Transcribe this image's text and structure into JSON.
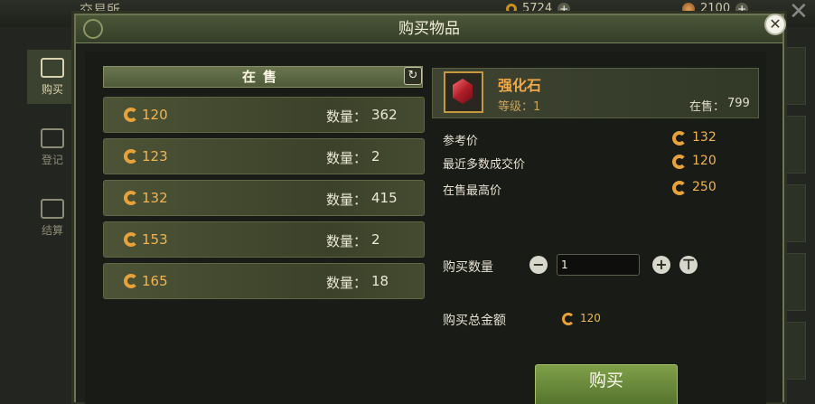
{
  "background": {
    "title": "交易所",
    "currency1_value": "5724",
    "currency2_value": "2100",
    "sidebar": [
      {
        "label": "购买",
        "active": true
      },
      {
        "label": "登记",
        "active": false
      },
      {
        "label": "结算",
        "active": false
      }
    ]
  },
  "modal": {
    "title": "购买物品",
    "list_header": "在售",
    "listings": [
      {
        "price": "120",
        "qty_label": "数量：",
        "qty": "362"
      },
      {
        "price": "123",
        "qty_label": "数量：",
        "qty": "2"
      },
      {
        "price": "132",
        "qty_label": "数量：",
        "qty": "415"
      },
      {
        "price": "153",
        "qty_label": "数量：",
        "qty": "2"
      },
      {
        "price": "165",
        "qty_label": "数量：",
        "qty": "18"
      }
    ],
    "item": {
      "name": "强化石",
      "level": "等级：1",
      "on_sale_label": "在售：",
      "on_sale_value": "799"
    },
    "stats": [
      {
        "label": "参考价",
        "value": "132"
      },
      {
        "label": "最近多数成交价",
        "value": "120"
      },
      {
        "label": "在售最高价",
        "value": "250"
      }
    ],
    "buy_qty_label": "购买数量",
    "buy_qty_value": "1",
    "total_label": "购买总金额",
    "total_value": "120",
    "buy_button": "购买"
  },
  "colors": {
    "accent_gold": "#f0b451",
    "header_green": "#4b5638",
    "buy_green": "#6b8a3c"
  },
  "icons": [
    "coin-icon",
    "refresh-icon",
    "minus-icon",
    "plus-icon",
    "max-icon",
    "close-icon",
    "gem-icon"
  ]
}
